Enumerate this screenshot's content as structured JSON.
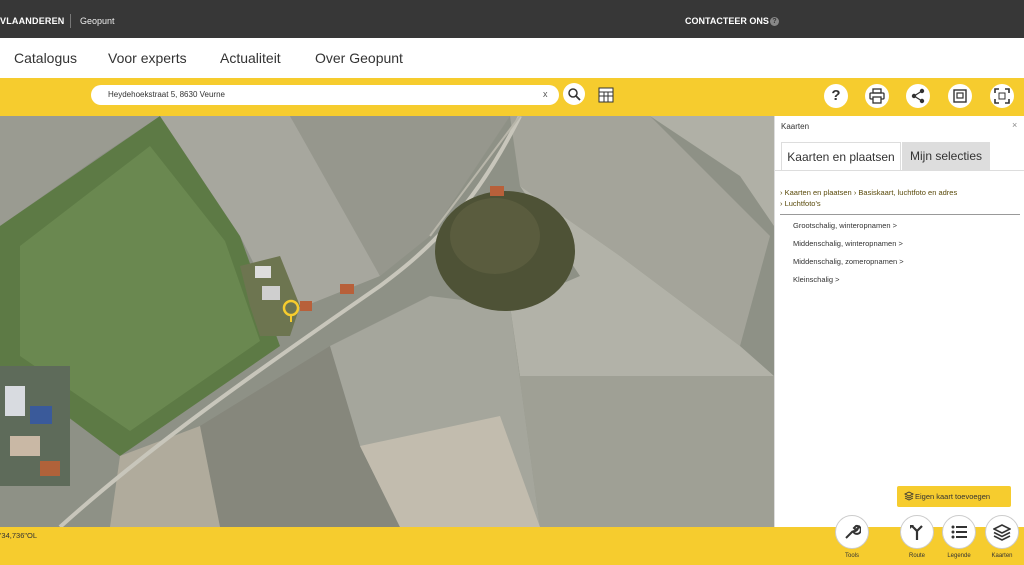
{
  "topbar": {
    "brand": "VLAANDEREN",
    "portal": "Geopunt",
    "contact": "CONTACTEER ONS",
    "help_glyph": "?"
  },
  "nav": {
    "items": [
      "Catalogus",
      "Voor experts",
      "Actualiteit",
      "Over Geopunt"
    ]
  },
  "search": {
    "value": "Heydehoekstraat 5, 8630 Veurne",
    "clear": "x",
    "icons": [
      "search-zoom-icon",
      "grid-icon"
    ]
  },
  "toolbar": {
    "icons": [
      "help-icon",
      "print-icon",
      "share-icon",
      "fullscreen-frame-icon",
      "expand-icon"
    ],
    "help_glyph": "?"
  },
  "panel": {
    "title": "Kaarten",
    "close": "×",
    "tabs": [
      "Kaarten en plaatsen",
      "Mijn selecties"
    ],
    "breadcrumb": {
      "part1": "Kaarten en plaatsen",
      "part2": "Basiskaart, luchtfoto en adres",
      "part3": "Luchtfoto's"
    },
    "items": [
      "Grootschalig, winteropnamen >",
      "Middenschalig, winteropnamen >",
      "Middenschalig, zomeropnamen >",
      "Kleinschalig >"
    ],
    "add_button": "Eigen kaart toevoegen"
  },
  "bottom": {
    "coords": "'34,736\"OL",
    "tools": [
      {
        "label": "Tools",
        "icon": "wrench-icon"
      },
      {
        "label": "Route",
        "icon": "route-icon"
      },
      {
        "label": "Legende",
        "icon": "list-icon"
      },
      {
        "label": "Kaarten",
        "icon": "layers-icon"
      }
    ]
  },
  "colors": {
    "accent": "#f6cc2e",
    "topbar": "#373737"
  }
}
